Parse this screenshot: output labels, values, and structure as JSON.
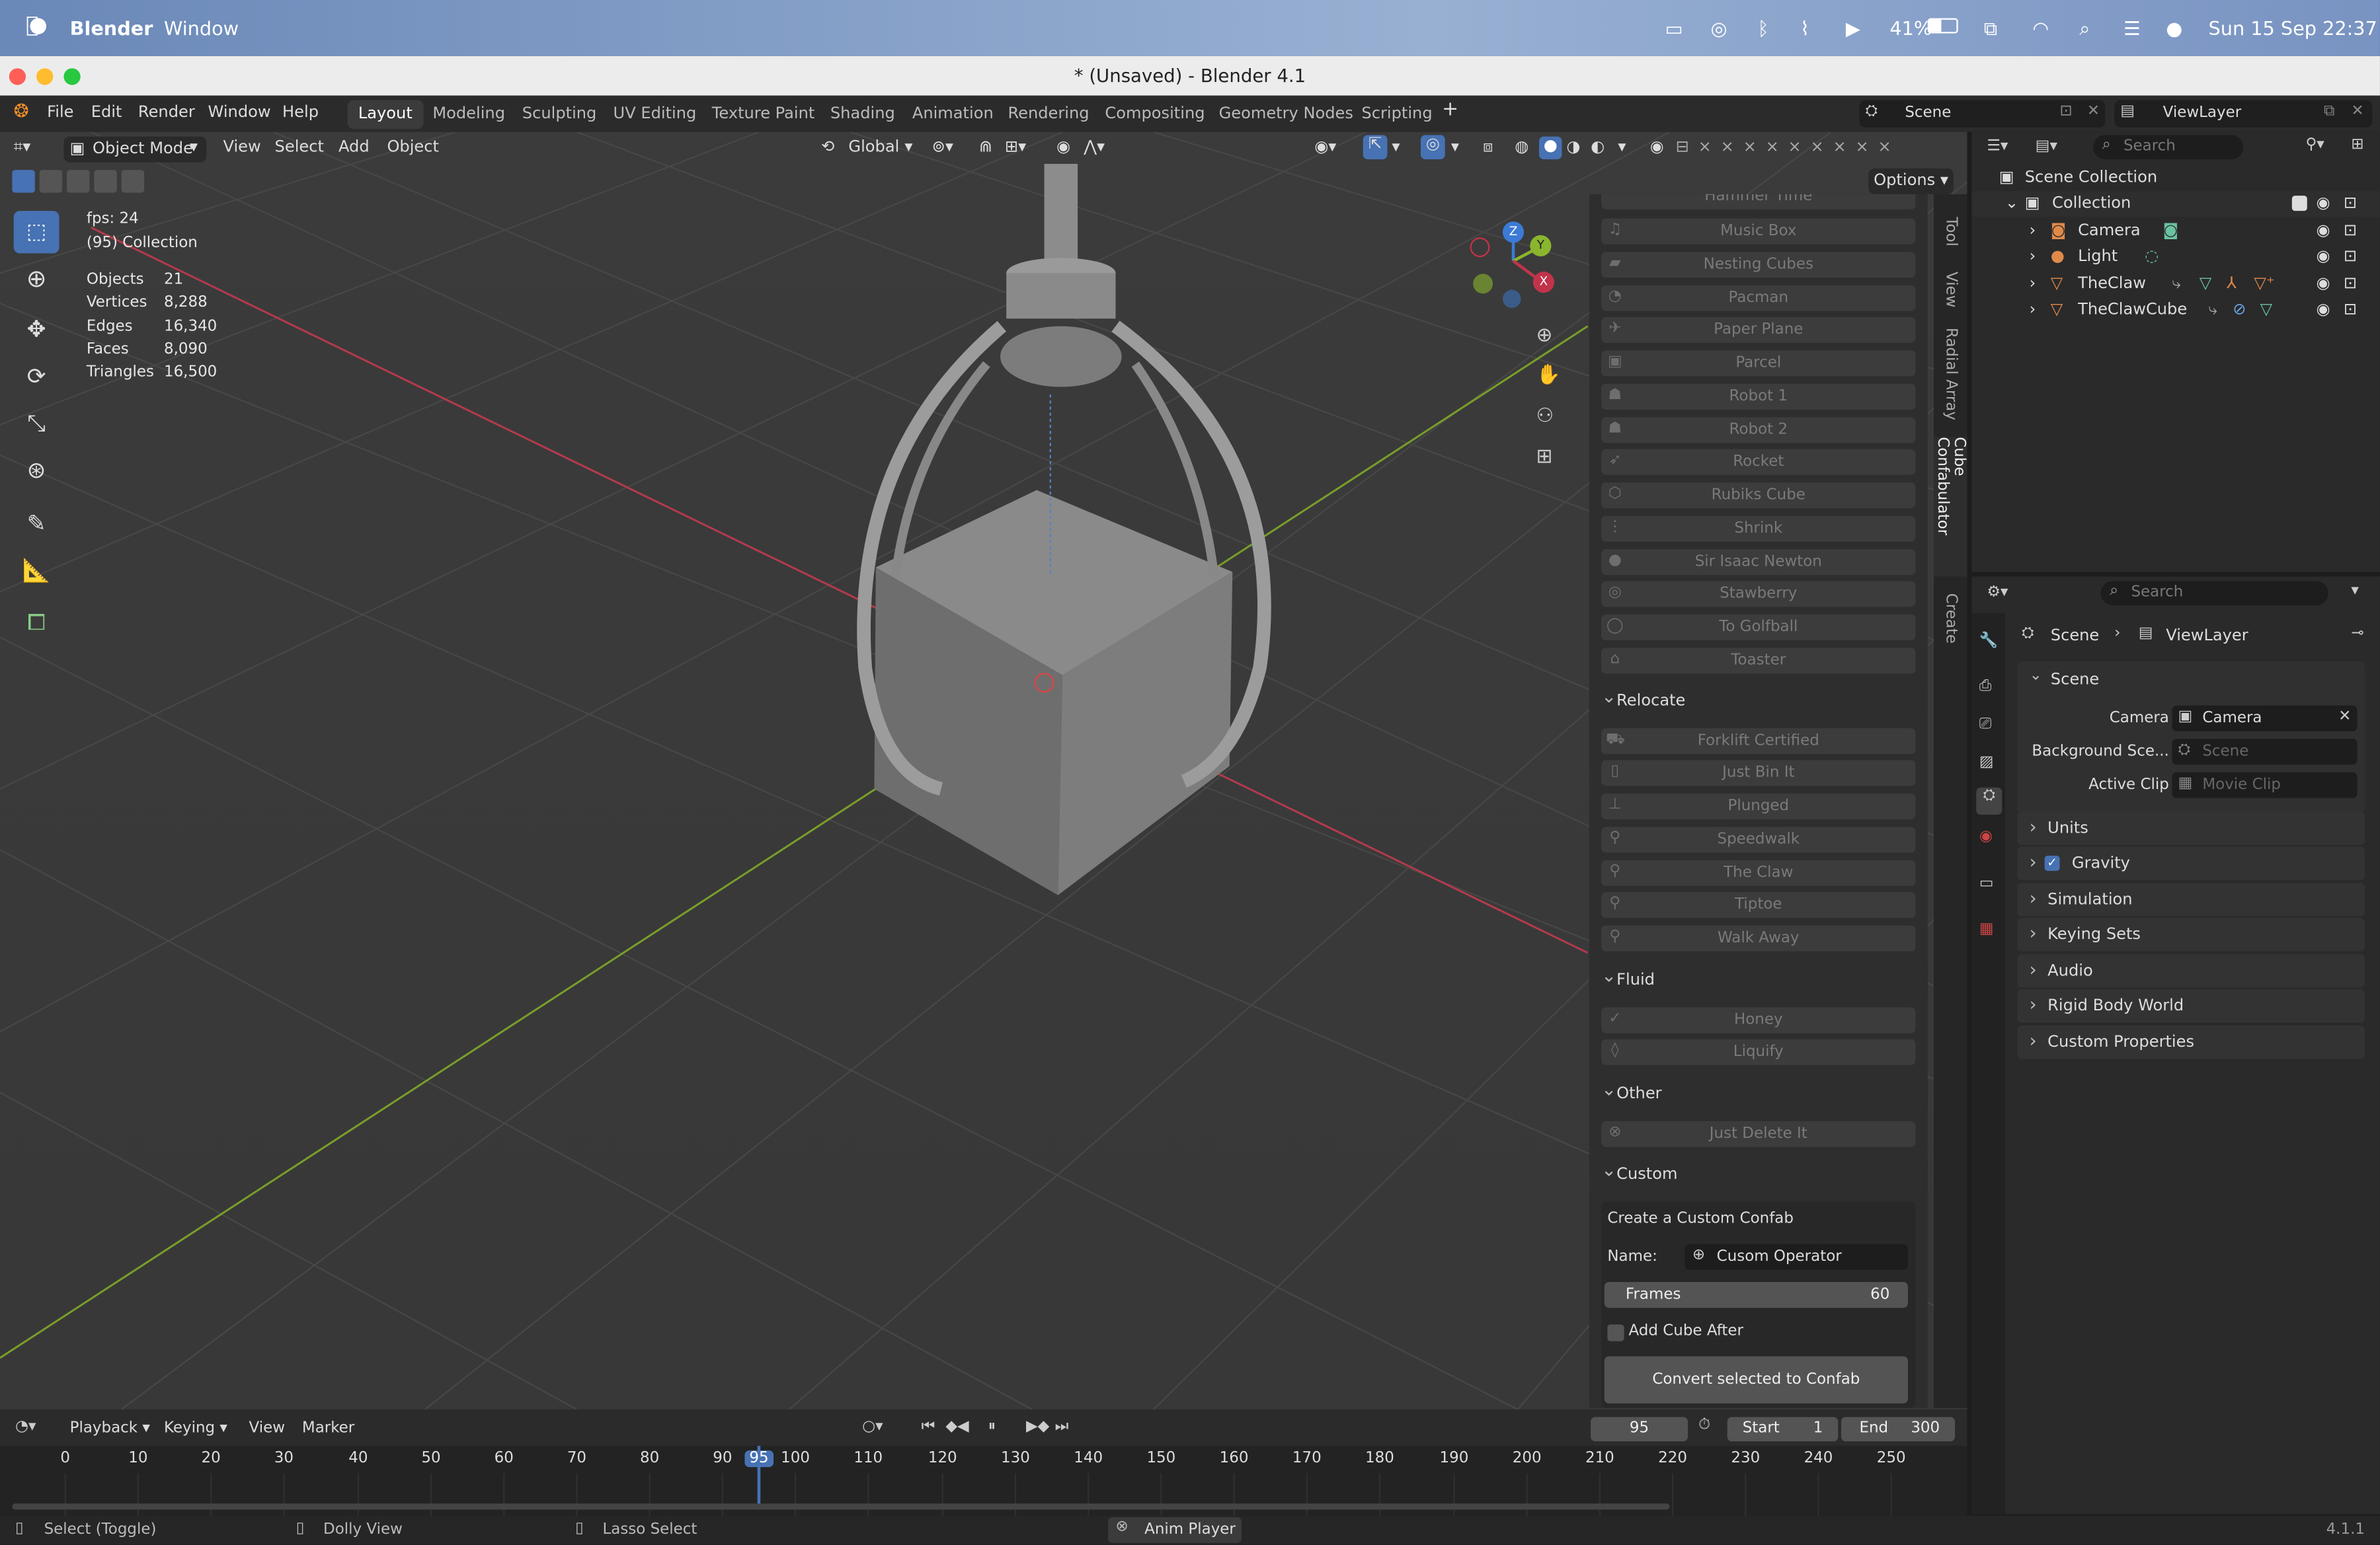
{
  "mac_menubar": {
    "apple": "",
    "app": "Blender",
    "window_menu": "Window",
    "battery": "41%",
    "datetime": "Sun 15 Sep  22:37"
  },
  "window": {
    "title": "* (Unsaved) - Blender 4.1"
  },
  "menubar": {
    "items": [
      "File",
      "Edit",
      "Render",
      "Window",
      "Help"
    ]
  },
  "workspaces": [
    "Layout",
    "Modeling",
    "Sculpting",
    "UV Editing",
    "Texture Paint",
    "Shading",
    "Animation",
    "Rendering",
    "Compositing",
    "Geometry Nodes",
    "Scripting"
  ],
  "active_workspace": "Layout",
  "scene_selector": {
    "label": "Scene"
  },
  "viewlayer_selector": {
    "label": "ViewLayer"
  },
  "viewport_header": {
    "mode": "Object Mode",
    "menus": [
      "View",
      "Select",
      "Add",
      "Object"
    ],
    "transform": "Global",
    "options": "Options"
  },
  "stats": {
    "fps": "fps: 24",
    "collection": "(95) Collection",
    "rows": [
      {
        "label": "Objects",
        "value": "21"
      },
      {
        "label": "Vertices",
        "value": "8,288"
      },
      {
        "label": "Edges",
        "value": "16,340"
      },
      {
        "label": "Faces",
        "value": "8,090"
      },
      {
        "label": "Triangles",
        "value": "16,500"
      }
    ]
  },
  "gizmo": {
    "z": "Z",
    "y": "Y",
    "x": "X"
  },
  "npanel": {
    "tabs": [
      "Tool",
      "View",
      "Radial Array",
      "Cube Confabulator",
      "Create"
    ],
    "top_partial": "Hammer Time",
    "items_main": [
      "Music Box",
      "Nesting Cubes",
      "Pacman",
      "Paper Plane",
      "Parcel",
      "Robot 1",
      "Robot 2",
      "Rocket",
      "Rubiks Cube",
      "Shrink",
      "Sir Isaac Newton",
      "Stawberry",
      "To Golfball",
      "Toaster"
    ],
    "relocate": {
      "title": "Relocate",
      "items": [
        "Forklift Certified",
        "Just Bin It",
        "Plunged",
        "Speedwalk",
        "The Claw",
        "Tiptoe",
        "Walk Away"
      ]
    },
    "fluid": {
      "title": "Fluid",
      "items": [
        "Honey",
        "Liquify"
      ]
    },
    "other": {
      "title": "Other",
      "items": [
        "Just Delete It"
      ]
    },
    "custom": {
      "title": "Custom",
      "create_label": "Create a Custom Confab",
      "name_label": "Name:",
      "name_value": "Cusom Operator",
      "frames_label": "Frames",
      "frames_value": "60",
      "add_cube_label": "Add Cube After",
      "convert_button": "Convert selected to Confab"
    }
  },
  "outliner": {
    "search_placeholder": "Search",
    "root": "Scene Collection",
    "collection": "Collection",
    "objects": [
      "Camera",
      "Light",
      "TheClaw",
      "TheClawCube"
    ]
  },
  "properties": {
    "search_placeholder": "Search",
    "breadcrumb": [
      "Scene",
      "ViewLayer"
    ],
    "scene_section": "Scene",
    "camera_label": "Camera",
    "camera_value": "Camera",
    "bg_label": "Background Sce...",
    "bg_value": "Scene",
    "clip_label": "Active Clip",
    "clip_value": "Movie Clip",
    "sections": [
      "Units",
      "Gravity",
      "Simulation",
      "Keying Sets",
      "Audio",
      "Rigid Body World",
      "Custom Properties"
    ]
  },
  "timeline": {
    "menus": [
      "Playback",
      "Keying",
      "View",
      "Marker"
    ],
    "current_frame": "95",
    "start_label": "Start",
    "start": "1",
    "end_label": "End",
    "end": "300",
    "ticks": [
      "0",
      "10",
      "20",
      "30",
      "40",
      "50",
      "60",
      "70",
      "80",
      "90",
      "95",
      "100",
      "110",
      "120",
      "130",
      "140",
      "150",
      "160",
      "170",
      "180",
      "190",
      "200",
      "210",
      "220",
      "230",
      "240",
      "250"
    ]
  },
  "statusbar": {
    "select": "Select (Toggle)",
    "dolly": "Dolly View",
    "lasso": "Lasso Select",
    "anim": "Anim Player",
    "version": "4.1.1"
  },
  "colors": {
    "accent": "#4772b3",
    "x_axis": "#c0344a",
    "y_axis": "#8ab52e",
    "z_axis": "#3b7bd6"
  }
}
